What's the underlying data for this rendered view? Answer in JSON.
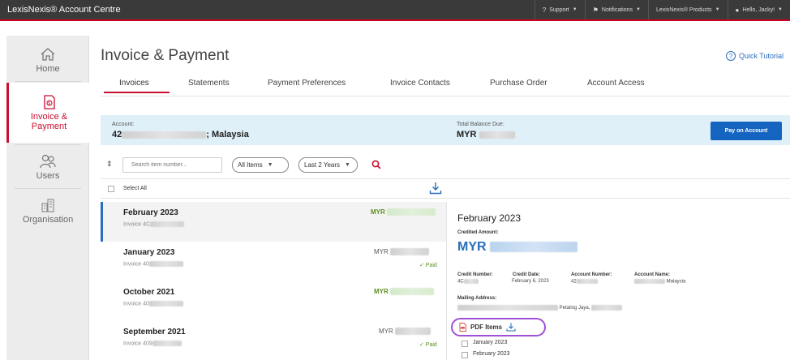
{
  "app": {
    "brand": "LexisNexis® Account Centre",
    "top_nav": [
      {
        "label": "Support",
        "icon": "help-icon"
      },
      {
        "label": "Notifications",
        "icon": "flag-icon"
      },
      {
        "label": "LexisNexis® Products",
        "icon": ""
      },
      {
        "label": "Hello, Jacky!",
        "icon": "user-icon"
      }
    ]
  },
  "sidebar": {
    "items": [
      {
        "label": "Home",
        "icon": "home-icon",
        "active": false
      },
      {
        "label": "Invoice & Payment",
        "icon": "invoice-icon",
        "active": true
      },
      {
        "label": "Users",
        "icon": "users-icon",
        "active": false
      },
      {
        "label": "Organisation",
        "icon": "building-icon",
        "active": false
      }
    ]
  },
  "page": {
    "title": "Invoice & Payment",
    "quick_tutorial": "Quick Tutorial",
    "tabs": [
      "Invoices",
      "Statements",
      "Payment Preferences",
      "Invoice Contacts",
      "Purchase Order",
      "Account Access"
    ],
    "active_tab": "Invoices"
  },
  "account": {
    "label": "Account:",
    "value_prefix": "42",
    "value_suffix": "; Malaysia",
    "balance_label": "Total Balance Due:",
    "balance_currency": "MYR",
    "pay_button": "Pay on Account"
  },
  "filters": {
    "search_placeholder": "Search item number...",
    "type_select": "All Items",
    "period_select": "Last 2 Years"
  },
  "list": {
    "select_all": "Select All",
    "rows": [
      {
        "month": "February 2023",
        "invoice": "Invoice 4C",
        "currency": "MYR",
        "status": ""
      },
      {
        "month": "January 2023",
        "invoice": "Invoice 40",
        "currency": "MYR",
        "status": "✓ Paid"
      },
      {
        "month": "October 2021",
        "invoice": "Invoice 40",
        "currency": "MYR",
        "status": ""
      },
      {
        "month": "September 2021",
        "invoice": "Invoice 409",
        "currency": "MYR",
        "status": "✓ Paid"
      }
    ]
  },
  "detail": {
    "title": "February 2023",
    "credited_label": "Credited Amount:",
    "amount_currency": "MYR",
    "credit_number_label": "Credit Number:",
    "credit_number_value": "4C",
    "credit_date_label": "Credit Date:",
    "credit_date_value": "February 6, 2023",
    "account_number_label": "Account Number:",
    "account_number_value": "42",
    "account_name_label": "Account Name:",
    "account_name_value": "Malaysia",
    "mailing_label": "Mailing Address:",
    "mailing_value": "Petaling Jaya,",
    "pdf_button": "PDF Items",
    "pdf_items": [
      "January 2023",
      "February 2023"
    ]
  },
  "colors": {
    "accent_red": "#c8102e",
    "link_blue": "#2a6ebb",
    "button_blue": "#1565c0",
    "paid_green": "#5c8d1e",
    "highlight_purple": "#a050d8"
  }
}
